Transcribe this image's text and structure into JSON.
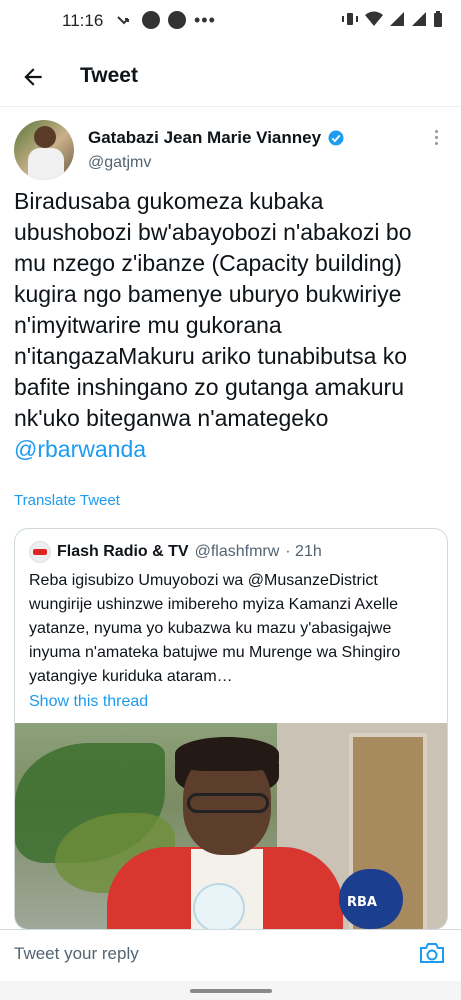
{
  "status_bar": {
    "time": "11:16"
  },
  "header": {
    "title": "Tweet"
  },
  "tweet": {
    "author": "Gatabazi Jean Marie Vianney",
    "handle": "@gatjmv",
    "text_main": "Biradusaba gukomeza kubaka ubushobozi bw'abayobozi n'abakozi bo mu nzego z'ibanze (Capacity building) kugira ngo bamenye uburyo bukwiriye n'imyitwarire mu gukorana n'itangazaMakuru ariko tunabibutsa ko bafite inshingano zo gutanga amakuru nk'uko biteganwa n'amategeko",
    "mention": "@rbarwanda",
    "translate_label": "Translate Tweet"
  },
  "quoted": {
    "name": "Flash Radio & TV",
    "handle": "@flashfmrw",
    "time": "· 21h",
    "text": "Reba igisubizo Umuyobozi wa @MusanzeDistrict wungirije ushinzwe imibereho myiza Kamanzi Axelle yatanze, nyuma yo kubazwa ku mazu y'abasigajwe inyuma n'amateka batujwe mu Murenge wa Shingiro yatangiye kuriduka ataram…",
    "show_thread": "Show this thread",
    "media_mic_label": "RBA"
  },
  "reply": {
    "placeholder": "Tweet your reply"
  },
  "colors": {
    "accent": "#1d9bf0",
    "verified": "#1d9bf0",
    "text": "#0f1419",
    "muted": "#536471"
  },
  "icons": [
    "back-arrow-icon",
    "verified-badge-icon",
    "more-options-icon",
    "camera-icon"
  ]
}
